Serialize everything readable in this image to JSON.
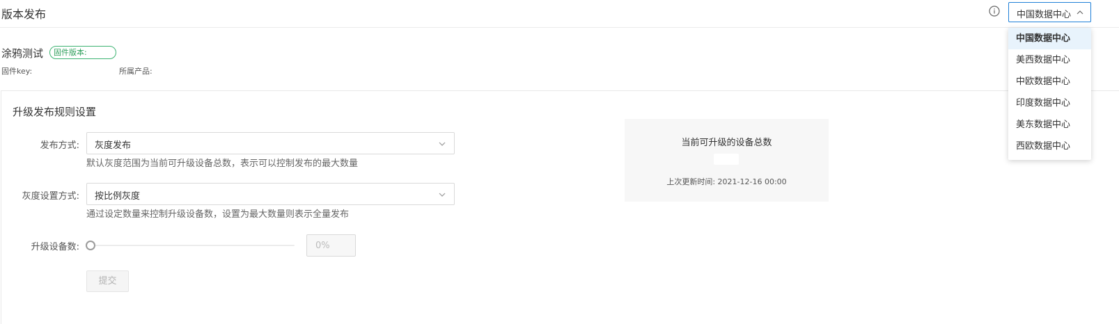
{
  "header": {
    "title": "版本发布",
    "region_selected": "中国数据中心"
  },
  "firmware": {
    "name": "涂鸦测试",
    "version_label": "固件版本:",
    "key_label": "固件key:",
    "product_label": "所属产品:"
  },
  "rules": {
    "section_title": "升级发布规则设置",
    "publish_method_label": "发布方式:",
    "publish_method_value": "灰度发布",
    "publish_method_hint": "默认灰度范围为当前可升级设备总数，表示可以控制发布的最大数量",
    "gray_mode_label": "灰度设置方式:",
    "gray_mode_value": "按比例灰度",
    "gray_mode_hint": "通过设定数量来控制升级设备数，设置为最大数量则表示全量发布",
    "device_count_label": "升级设备数:",
    "device_count_percent": "0%",
    "device_count_slider_value": 0,
    "submit_label": "提交"
  },
  "stats": {
    "title": "当前可升级的设备总数",
    "last_updated": "上次更新时间: 2021-12-16 00:00"
  },
  "region_dropdown": {
    "options": [
      "中国数据中心",
      "美西数据中心",
      "中欧数据中心",
      "印度数据中心",
      "美东数据中心",
      "西欧数据中心"
    ],
    "selected_index": 0
  },
  "colors": {
    "accent": "#1e7fd8",
    "badge_green": "#3cb371",
    "selected_bg": "#e8f3fc"
  }
}
